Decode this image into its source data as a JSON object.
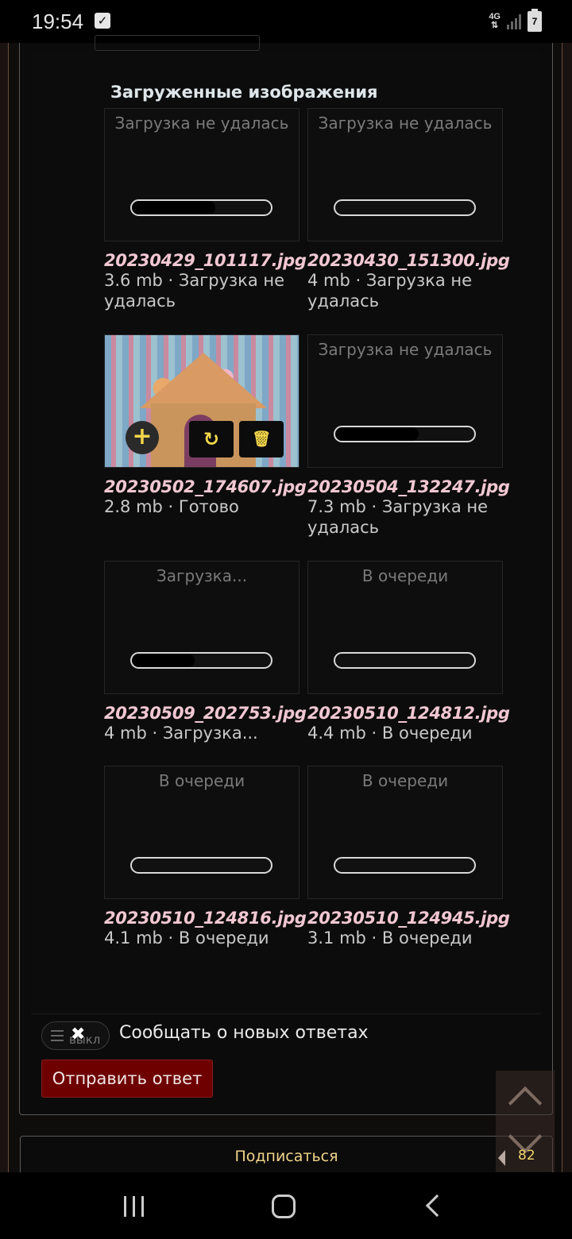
{
  "status_bar": {
    "time": "19:54",
    "network": "4G",
    "battery": "7"
  },
  "uploads": {
    "title": "Загруженные изображения",
    "tiles": [
      {
        "thumb_status": "Загрузка не удалась",
        "progress": 0.6,
        "filename": "20230429_101117.jpg",
        "meta": "3.6 mb · Загрузка не удалась"
      },
      {
        "thumb_status": "Загрузка не удалась",
        "progress": 0.0,
        "filename": "20230430_151300.jpg",
        "meta": "4 mb · Загрузка не удалась"
      },
      {
        "thumb_status": "",
        "progress": 1.0,
        "filename": "20230502_174607.jpg",
        "meta": "2.8 mb · Готово"
      },
      {
        "thumb_status": "Загрузка не удалась",
        "progress": 0.6,
        "filename": "20230504_132247.jpg",
        "meta": "7.3 mb · Загрузка не удалась"
      },
      {
        "thumb_status": "Загрузка...",
        "progress": 0.45,
        "filename": "20230509_202753.jpg",
        "meta": "4 mb · Загрузка..."
      },
      {
        "thumb_status": "В очереди",
        "progress": 0.0,
        "filename": "20230510_124812.jpg",
        "meta": "4.4 mb · В очереди"
      },
      {
        "thumb_status": "В очереди",
        "progress": 0.0,
        "filename": "20230510_124816.jpg",
        "meta": "4.1 mb · В очереди"
      },
      {
        "thumb_status": "В очереди",
        "progress": 0.0,
        "filename": "20230510_124945.jpg",
        "meta": "3.1 mb · В очереди"
      }
    ],
    "image_actions": {
      "add": "+",
      "reload": "↻",
      "delete": "🗑"
    }
  },
  "notify": {
    "toggle_state": "выкл",
    "label": "Сообщать о новых ответах"
  },
  "send_button": "Отправить ответ",
  "subscribe_button": "Подписаться",
  "reply_count": "82"
}
